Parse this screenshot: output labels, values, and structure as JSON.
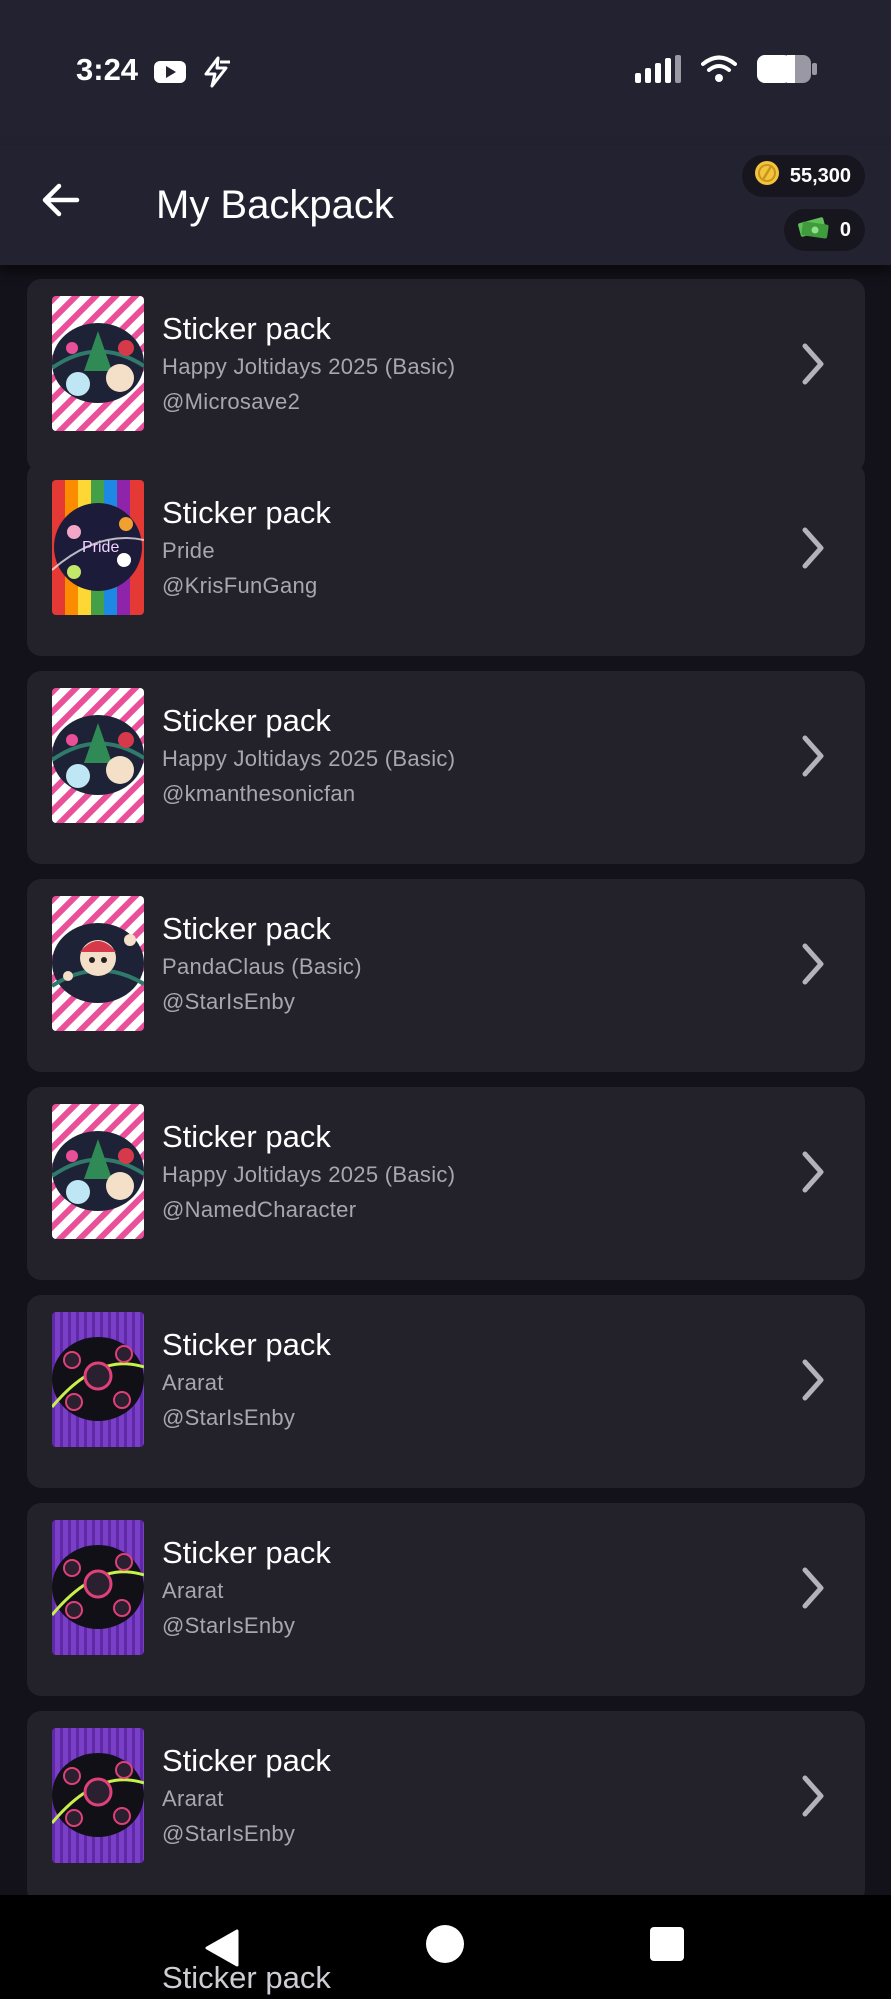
{
  "status_bar": {
    "time": "3:24",
    "left_icons": [
      "youtube-icon",
      "lightning-app-icon"
    ],
    "right_icons": [
      "signal-icon",
      "wifi-icon",
      "battery-icon"
    ]
  },
  "header": {
    "title": "My Backpack",
    "back_icon": "arrow-left-icon",
    "coins": "55,300",
    "cash": "0"
  },
  "items": [
    {
      "title": "Sticker pack",
      "subtitle": "Happy Joltidays 2025 (Basic)",
      "user": "@Microsave2",
      "theme": "holiday"
    },
    {
      "title": "Sticker pack",
      "subtitle": "Pride",
      "user": "@KrisFunGang",
      "theme": "pride"
    },
    {
      "title": "Sticker pack",
      "subtitle": "Happy Joltidays 2025 (Basic)",
      "user": "@kmanthesonicfan",
      "theme": "holiday"
    },
    {
      "title": "Sticker pack",
      "subtitle": "PandaClaus (Basic)",
      "user": "@StarIsEnby",
      "theme": "panda"
    },
    {
      "title": "Sticker pack",
      "subtitle": "Happy Joltidays 2025 (Basic)",
      "user": "@NamedCharacter",
      "theme": "holiday"
    },
    {
      "title": "Sticker pack",
      "subtitle": "Ararat",
      "user": "@StarIsEnby",
      "theme": "ararat"
    },
    {
      "title": "Sticker pack",
      "subtitle": "Ararat",
      "user": "@StarIsEnby",
      "theme": "ararat"
    },
    {
      "title": "Sticker pack",
      "subtitle": "Ararat",
      "user": "@StarIsEnby",
      "theme": "ararat"
    }
  ],
  "peek_item": {
    "title": "Sticker pack"
  },
  "colors": {
    "background": "#131119",
    "header": "#232231",
    "card": "#23212a",
    "secondary_text": "#a9a7ae",
    "coin": "#f2c53d",
    "cash": "#5fbf5a"
  },
  "nav": {
    "icons": [
      "nav-back-icon",
      "nav-home-icon",
      "nav-recents-icon"
    ]
  }
}
